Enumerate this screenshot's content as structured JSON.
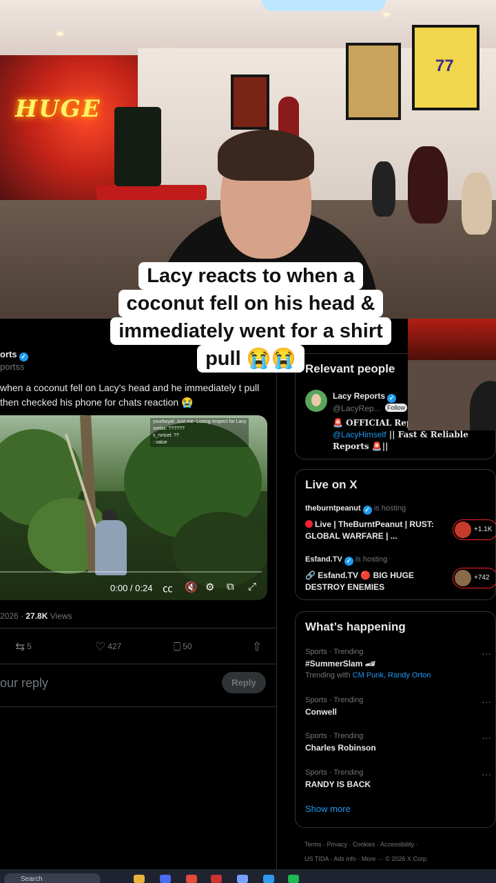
{
  "caption": {
    "lines": [
      "Lacy reacts to when a",
      "coconut fell on his head &",
      "immediately went for a shirt",
      "pull 😭😭"
    ]
  },
  "stream": {
    "neon_sign": "HUGE",
    "jersey_number": "77"
  },
  "post": {
    "author_name": "orts",
    "author_handle": "portss",
    "text": "when a coconut fell on Lacy's head and he immediately t pull then checked his phone for chats reaction 😭",
    "video": {
      "chat_lines": [
        "yourboyal: Just me- Losing respect for Lacy",
        "xrelax: ??????",
        "s_rvricel: ??",
        ": value"
      ],
      "progress": 0.0,
      "time": "0:00 / 0:24"
    },
    "date": "2026",
    "views": "27.8K",
    "views_label": "Views",
    "reposts": "5",
    "likes": "427",
    "bookmarks": "50",
    "reply_placeholder": "our reply",
    "reply_button": "Reply"
  },
  "relevant_people": {
    "title": "Relevant people",
    "name": "Lacy Reports",
    "handle": "@LacyRep...",
    "follow": "Follow",
    "bio_prefix": "🚨 OFFICIAL Repo",
    "bio_link": "@LacyHimself",
    "bio_suffix": "|| Fast & Reliable Reports 🚨||"
  },
  "live_on_x": {
    "title": "Live on X",
    "items": [
      {
        "host": "theburntpeanut",
        "status": "is hosting",
        "text": "Live | TheBurntPeanut | RUST: GLOBAL WARFARE | ...",
        "count": "+1.1K"
      },
      {
        "host": "Esfand.TV",
        "status": "is hosting",
        "text": "Esfand.TV 🔴 BIG HUGE DESTROY ENEMIES",
        "count": "+742"
      }
    ]
  },
  "whats_happening": {
    "title": "What’s happening",
    "trends": [
      {
        "meta": "Sports · Trending",
        "name": "#SummerSlam 🏎",
        "with_prefix": "Trending with",
        "with_links": "CM Punk, Randy Orton"
      },
      {
        "meta": "Sports · Trending",
        "name": "Conwell"
      },
      {
        "meta": "Sports · Trending",
        "name": "Charles Robinson"
      },
      {
        "meta": "Sports · Trending",
        "name": "RANDY IS BACK"
      }
    ],
    "more_glyph": "···",
    "show_more": "Show more"
  },
  "footer": {
    "line1": "Terms  ·  Privacy  ·  Cookies  ·  Accessibility  ·",
    "line2": "US TIDA  ·  Ads info  ·  More ···  © 2026 X Corp."
  },
  "taskbar": {
    "search": "Search"
  },
  "colors": {
    "accent": "#1d9bf0",
    "live_red": "#f4212e",
    "caption_bg": "#ffffff"
  }
}
